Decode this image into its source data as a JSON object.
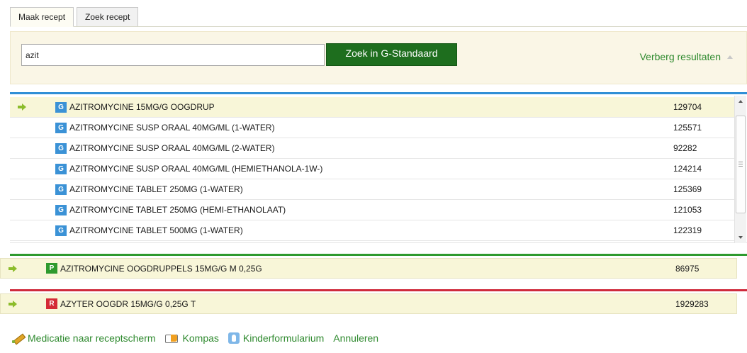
{
  "tabs": [
    {
      "label": "Maak recept",
      "active": true
    },
    {
      "label": "Zoek recept",
      "active": false
    }
  ],
  "search": {
    "value": "azit",
    "button_label": "Zoek in G-Standaard",
    "toggle_label": "Verberg resultaten"
  },
  "groups": {
    "generic": {
      "color": "#2f8fd6",
      "badge": "G",
      "rows": [
        {
          "name": "AZITROMYCINE 15MG/G OOGDRUP",
          "code": "129704",
          "highlighted": true
        },
        {
          "name": "AZITROMYCINE SUSP ORAAL 40MG/ML (1-WATER)",
          "code": "125571",
          "highlighted": false
        },
        {
          "name": "AZITROMYCINE SUSP ORAAL 40MG/ML (2-WATER)",
          "code": "92282",
          "highlighted": false
        },
        {
          "name": "AZITROMYCINE SUSP ORAAL 40MG/ML (HEMIETHANOLA-1W-)",
          "code": "124214",
          "highlighted": false
        },
        {
          "name": "AZITROMYCINE TABLET 250MG (1-WATER)",
          "code": "125369",
          "highlighted": false
        },
        {
          "name": "AZITROMYCINE TABLET 250MG (HEMI-ETHANOLAAT)",
          "code": "121053",
          "highlighted": false
        },
        {
          "name": "AZITROMYCINE TABLET 500MG (1-WATER)",
          "code": "122319",
          "highlighted": false
        }
      ]
    },
    "product": {
      "color": "#2e9a2e",
      "badge": "P",
      "row": {
        "name": "AZITROMYCINE OOGDRUPPELS 15MG/G M 0,25G",
        "code": "86975"
      }
    },
    "brand": {
      "color": "#cf2a3c",
      "badge": "R",
      "row": {
        "name": "AZYTER OOGDR 15MG/G 0,25G T",
        "code": "1929283"
      }
    }
  },
  "actions": [
    {
      "label": "Medicatie naar receptscherm",
      "icon": "pencil-icon"
    },
    {
      "label": "Kompas",
      "icon": "compass-icon"
    },
    {
      "label": "Kinderformularium",
      "icon": "hand-icon"
    },
    {
      "label": "Annuleren",
      "icon": ""
    }
  ]
}
